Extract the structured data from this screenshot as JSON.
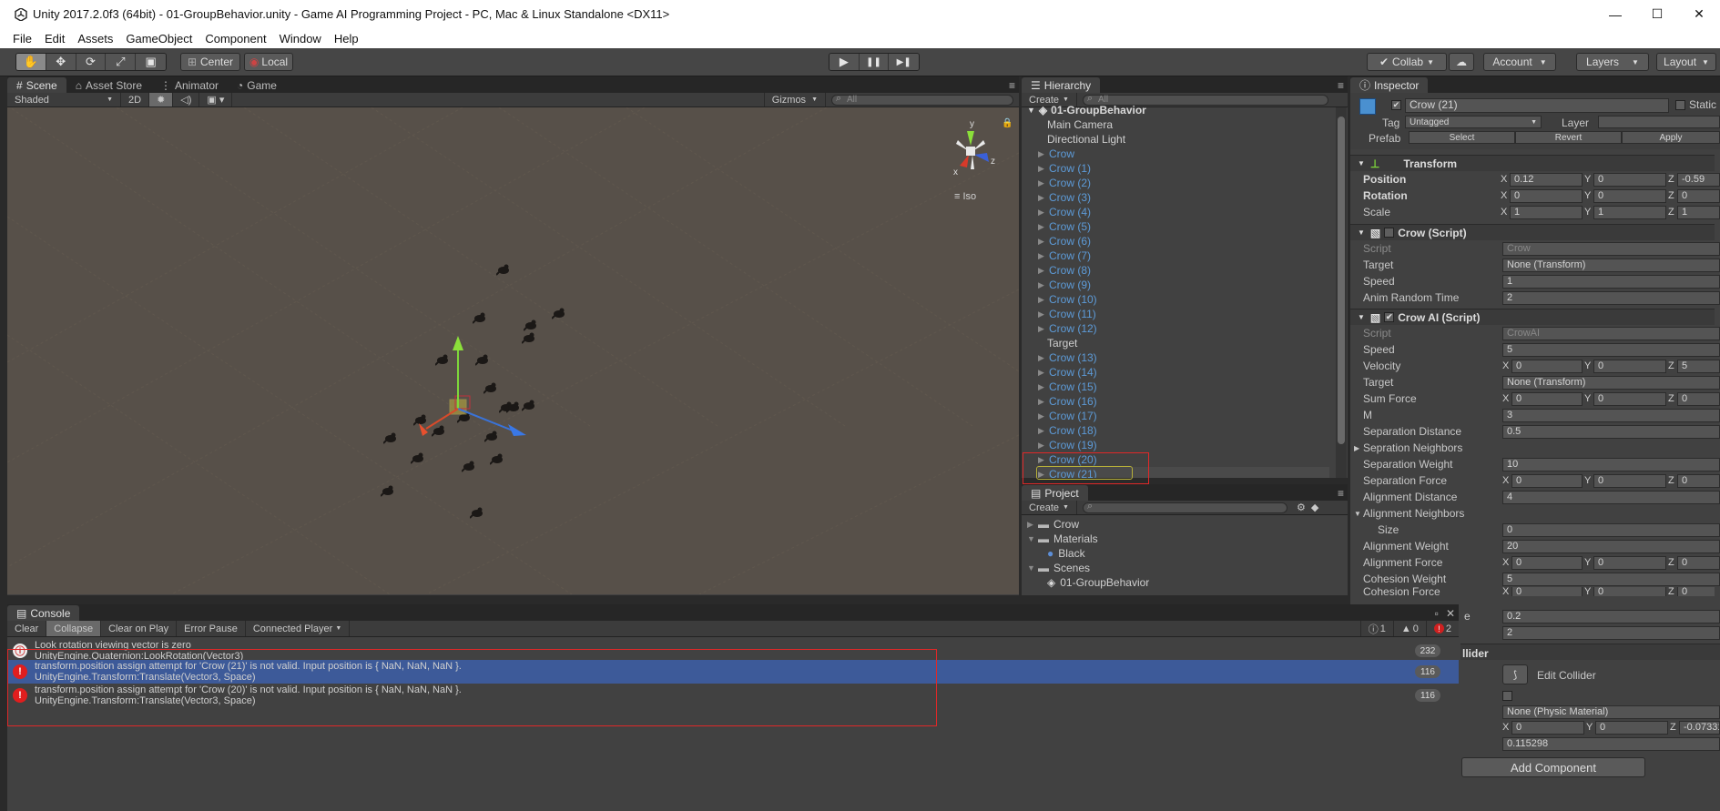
{
  "titlebar": {
    "title": "Unity 2017.2.0f3 (64bit) - 01-GroupBehavior.unity - Game AI Programming Project - PC, Mac & Linux Standalone <DX11>",
    "minimize": "—",
    "maximize": "☐",
    "close": "✕"
  },
  "menu": [
    "File",
    "Edit",
    "Assets",
    "GameObject",
    "Component",
    "Window",
    "Help"
  ],
  "toolbar": {
    "tools": [
      "✋",
      "✥",
      "⟳",
      "⤢",
      "▣"
    ],
    "pivot": "Center",
    "space": "Local",
    "play": "▶",
    "pause": "❚❚",
    "step": "▶❚",
    "collab": "Collab",
    "cloud": "☁",
    "account": "Account",
    "layers": "Layers",
    "layout": "Layout"
  },
  "scene_panel": {
    "tabs": [
      "Scene",
      "Asset Store",
      "Animator",
      "Game"
    ],
    "shading": "Shaded",
    "mode_2d": "2D",
    "gizmos": "Gizmos",
    "search_placeholder": "All",
    "gizmo_y": "y",
    "gizmo_x": "x",
    "gizmo_z": "z",
    "iso": "Iso"
  },
  "hierarchy": {
    "tab": "Hierarchy",
    "create": "Create",
    "search_placeholder": "All",
    "scene_name": "01-GroupBehavior",
    "items": [
      {
        "label": "Main Camera",
        "blue": false,
        "arrow": false
      },
      {
        "label": "Directional Light",
        "blue": false,
        "arrow": false
      },
      {
        "label": "Crow",
        "blue": true,
        "arrow": true
      },
      {
        "label": "Crow (1)",
        "blue": true,
        "arrow": true
      },
      {
        "label": "Crow (2)",
        "blue": true,
        "arrow": true
      },
      {
        "label": "Crow (3)",
        "blue": true,
        "arrow": true
      },
      {
        "label": "Crow (4)",
        "blue": true,
        "arrow": true
      },
      {
        "label": "Crow (5)",
        "blue": true,
        "arrow": true
      },
      {
        "label": "Crow (6)",
        "blue": true,
        "arrow": true
      },
      {
        "label": "Crow (7)",
        "blue": true,
        "arrow": true
      },
      {
        "label": "Crow (8)",
        "blue": true,
        "arrow": true
      },
      {
        "label": "Crow (9)",
        "blue": true,
        "arrow": true
      },
      {
        "label": "Crow (10)",
        "blue": true,
        "arrow": true
      },
      {
        "label": "Crow (11)",
        "blue": true,
        "arrow": true
      },
      {
        "label": "Crow (12)",
        "blue": true,
        "arrow": true
      },
      {
        "label": "Target",
        "blue": false,
        "arrow": false
      },
      {
        "label": "Crow (13)",
        "blue": true,
        "arrow": true
      },
      {
        "label": "Crow (14)",
        "blue": true,
        "arrow": true
      },
      {
        "label": "Crow (15)",
        "blue": true,
        "arrow": true
      },
      {
        "label": "Crow (16)",
        "blue": true,
        "arrow": true
      },
      {
        "label": "Crow (17)",
        "blue": true,
        "arrow": true
      },
      {
        "label": "Crow (18)",
        "blue": true,
        "arrow": true
      },
      {
        "label": "Crow (19)",
        "blue": true,
        "arrow": true
      },
      {
        "label": "Crow (20)",
        "blue": true,
        "arrow": true
      },
      {
        "label": "Crow (21)",
        "blue": true,
        "arrow": true
      }
    ]
  },
  "project": {
    "tab": "Project",
    "create": "Create",
    "items": [
      {
        "label": "Crow",
        "type": "folder",
        "indent": 0
      },
      {
        "label": "Materials",
        "type": "folder",
        "indent": 0
      },
      {
        "label": "Black",
        "type": "material",
        "indent": 1
      },
      {
        "label": "Scenes",
        "type": "folder",
        "indent": 0
      },
      {
        "label": "01-GroupBehavior",
        "type": "scene",
        "indent": 1
      }
    ]
  },
  "inspector": {
    "tab": "Inspector",
    "object_name": "Crow (21)",
    "static": "Static",
    "tag_label": "Tag",
    "tag_value": "Untagged",
    "layer_label": "Layer",
    "prefab_label": "Prefab",
    "prefab_select": "Select",
    "prefab_revert": "Revert",
    "prefab_apply": "Apply",
    "transform": {
      "title": "Transform",
      "position_label": "Position",
      "position": {
        "x": "0.12",
        "y": "0",
        "z": "-0.59"
      },
      "rotation_label": "Rotation",
      "rotation": {
        "x": "0",
        "y": "0",
        "z": "0"
      },
      "scale_label": "Scale",
      "scale": {
        "x": "1",
        "y": "1",
        "z": "1"
      }
    },
    "crow_script": {
      "title": "Crow (Script)",
      "script_label": "Script",
      "script_value": "Crow",
      "target_label": "Target",
      "target_value": "None (Transform)",
      "speed_label": "Speed",
      "speed_value": "1",
      "anim_label": "Anim Random Time",
      "anim_value": "2"
    },
    "crowai_script": {
      "title": "Crow AI (Script)",
      "script_label": "Script",
      "script_value": "CrowAI",
      "speed_label": "Speed",
      "speed_value": "5",
      "velocity_label": "Velocity",
      "velocity": {
        "x": "0",
        "y": "0",
        "z": "5"
      },
      "target_label": "Target",
      "target_value": "None (Transform)",
      "sumforce_label": "Sum Force",
      "sumforce": {
        "x": "0",
        "y": "0",
        "z": "0"
      },
      "m_label": "M",
      "m_value": "3",
      "sepdist_label": "Separation Distance",
      "sepdist_value": "0.5",
      "sepneigh_label": "Sepration Neighbors",
      "sepweight_label": "Separation Weight",
      "sepweight_value": "10",
      "sepforce_label": "Separation Force",
      "sepforce": {
        "x": "0",
        "y": "0",
        "z": "0"
      },
      "aligndist_label": "Alignment Distance",
      "aligndist_value": "4",
      "alignneigh_label": "Alignment Neighbors",
      "size_label": "Size",
      "size_value": "0",
      "alignweight_label": "Alignment Weight",
      "alignweight_value": "20",
      "alignforce_label": "Alignment Force",
      "alignforce": {
        "x": "0",
        "y": "0",
        "z": "0"
      },
      "cohweight_label": "Cohesion Weight",
      "cohweight_value": "5",
      "cohforce_label": "Cohesion Force",
      "cohforce": {
        "x": "0",
        "y": "0",
        "z": "0"
      },
      "row_a_value": "0.2",
      "row_b_suffix": "e",
      "row_b_value": "2"
    },
    "collider": {
      "title_fragment": "llider",
      "edit_collider": "Edit Collider",
      "material_value": "None (Physic Material)",
      "center": {
        "x": "0",
        "y": "0",
        "z": "-0.07331"
      },
      "radius_value": "0.115298"
    },
    "add_component": "Add Component"
  },
  "console": {
    "tab": "Console",
    "clear": "Clear",
    "collapse": "Collapse",
    "clear_on_play": "Clear on Play",
    "error_pause": "Error Pause",
    "connected_player": "Connected Player",
    "count_info": "1",
    "count_warn": "0",
    "count_error": "2",
    "logs": [
      {
        "l1": "Look rotation viewing vector is zero",
        "l2": "UnityEngine.Quaternion:LookRotation(Vector3)",
        "count": "232",
        "type": "info",
        "selected": false
      },
      {
        "l1": "transform.position assign attempt for 'Crow (21)' is not valid. Input position is { NaN, NaN, NaN }.",
        "l2": "UnityEngine.Transform:Translate(Vector3, Space)",
        "count": "116",
        "type": "error",
        "selected": true
      },
      {
        "l1": "transform.position assign attempt for 'Crow (20)' is not valid. Input position is { NaN, NaN, NaN }.",
        "l2": "UnityEngine.Transform:Translate(Vector3, Space)",
        "count": "116",
        "type": "error",
        "selected": false
      }
    ]
  },
  "colors": {
    "accent_blue": "#3d5a99",
    "hierarchy_blue": "#5d9bd8",
    "error_red": "#e02828",
    "scene_bg": "#575049"
  }
}
